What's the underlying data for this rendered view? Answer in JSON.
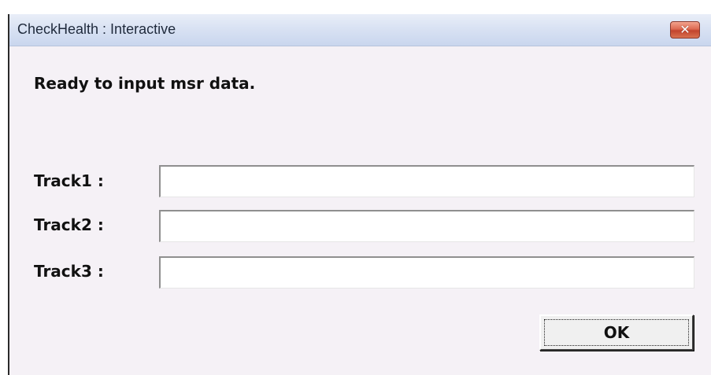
{
  "window": {
    "title": "CheckHealth : Interactive",
    "close_glyph": "✕"
  },
  "message": "Ready to input msr data.",
  "tracks": [
    {
      "label": "Track1 :",
      "value": ""
    },
    {
      "label": "Track2 :",
      "value": ""
    },
    {
      "label": "Track3 :",
      "value": ""
    }
  ],
  "ok_button": {
    "label": "OK"
  },
  "colors": {
    "dialog_background": "#f5f1f6",
    "titlebar": "#d9e2f3",
    "close_button": "#d9604a"
  }
}
